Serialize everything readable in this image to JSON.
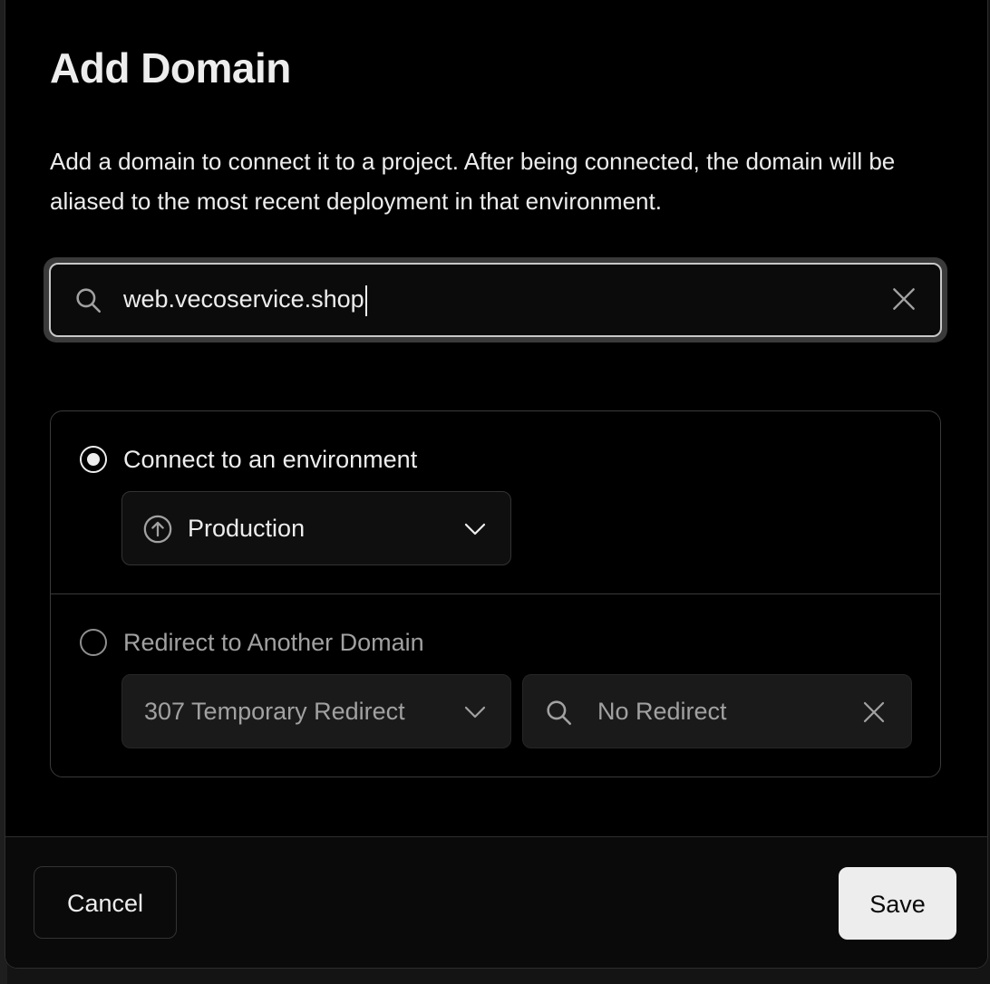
{
  "dialog": {
    "title": "Add Domain",
    "description": "Add a domain to connect it to a project. After being connected, the domain will be aliased to the most recent deployment in that environment."
  },
  "search": {
    "value": "web.vecoservice.shop",
    "icon": "search-icon",
    "clear_icon": "close-icon"
  },
  "options": {
    "connect": {
      "label": "Connect to an environment",
      "selected": true,
      "environment": {
        "value": "Production",
        "icon": "arrow-up-circle-icon"
      }
    },
    "redirect": {
      "label": "Redirect to Another Domain",
      "selected": false,
      "status_code": "307 Temporary Redirect",
      "target_placeholder": "No Redirect"
    }
  },
  "footer": {
    "cancel_label": "Cancel",
    "save_label": "Save"
  },
  "colors": {
    "background": "#000000",
    "text": "#ededed",
    "muted_text": "#a1a1a1",
    "border": "#3a3a3a",
    "primary_button": "#ededed"
  }
}
